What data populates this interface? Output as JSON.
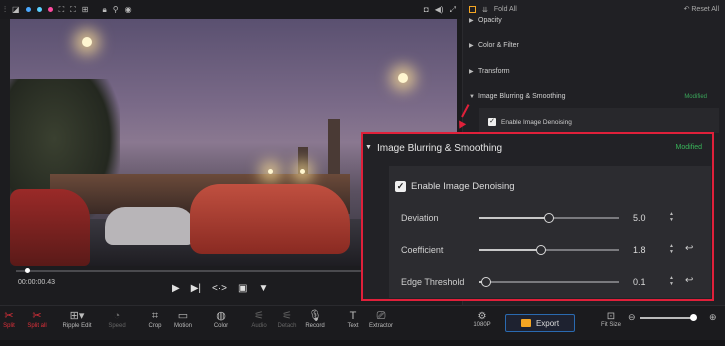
{
  "right_panel": {
    "fold_all": "Fold All",
    "reset_all": "Reset All",
    "sections": [
      "Opacity",
      "Color & Filter",
      "Transform",
      "Image Blurring & Smoothing"
    ],
    "modified": "Modified",
    "enable_label": "Enable Image Denoising"
  },
  "zoom_panel": {
    "title": "Image Blurring & Smoothing",
    "modified": "Modified",
    "enable_label": "Enable Image Denoising",
    "enable_checked": true,
    "params": [
      {
        "label": "Deviation",
        "value": "5.0",
        "level": 0.5,
        "reset": false
      },
      {
        "label": "Coefficient",
        "value": "1.8",
        "level": 0.44,
        "reset": true
      },
      {
        "label": "Edge Threshold",
        "value": "0.1",
        "level": 0.05,
        "reset": true
      }
    ]
  },
  "player": {
    "timecode": "00:00:00.43",
    "progress": 0.02
  },
  "toolbar": {
    "split": "Split",
    "split_all": "Split all",
    "ripple_edit": "Ripple Edit",
    "speed": "Speed",
    "crop": "Crop",
    "motion": "Motion",
    "color": "Color",
    "audio": "Audio",
    "detach": "Detach",
    "record": "Record",
    "text": "Text",
    "extractor": "Extractor",
    "resolution": "1080P",
    "export": "Export",
    "fit_size": "Fit Size"
  },
  "colors": {
    "accent": "#e0203a",
    "modified": "#39b55a",
    "brand": "#f5a623"
  }
}
